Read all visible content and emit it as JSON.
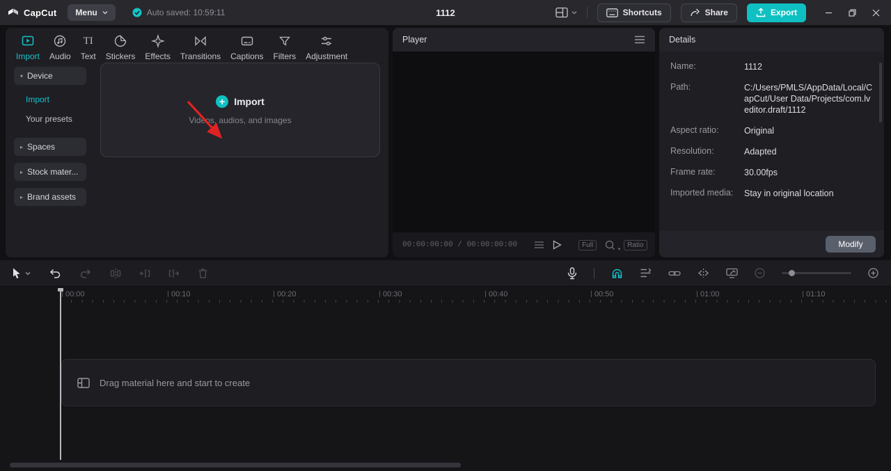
{
  "topbar": {
    "logo_text": "CapCut",
    "menu_label": "Menu",
    "autosave_text": "Auto saved: 10:59:11",
    "project_title": "1112",
    "shortcuts_label": "Shortcuts",
    "share_label": "Share",
    "export_label": "Export"
  },
  "media": {
    "tabs": [
      {
        "label": "Import"
      },
      {
        "label": "Audio"
      },
      {
        "label": "Text"
      },
      {
        "label": "Stickers"
      },
      {
        "label": "Effects"
      },
      {
        "label": "Transitions"
      },
      {
        "label": "Captions"
      },
      {
        "label": "Filters"
      },
      {
        "label": "Adjustment"
      }
    ],
    "text_icon_glyph": "TI",
    "sidebar": {
      "device": "Device",
      "import": "Import",
      "your_presets": "Your presets",
      "spaces": "Spaces",
      "stock_materials": "Stock mater...",
      "brand_assets": "Brand assets"
    },
    "import_zone": {
      "title": "Import",
      "subtitle": "Videos, audios, and images"
    }
  },
  "player": {
    "title": "Player",
    "time_current": "00:00:00:00",
    "time_separator": "/",
    "time_total": "00:00:00:00",
    "full_label": "Full",
    "ratio_label": "Ratio"
  },
  "details": {
    "title": "Details",
    "rows": [
      {
        "label": "Name:",
        "value": "1112"
      },
      {
        "label": "Path:",
        "value": "C:/Users/PMLS/AppData/Local/CapCut/User Data/Projects/com.lveditor.draft/1112"
      },
      {
        "label": "Aspect ratio:",
        "value": "Original"
      },
      {
        "label": "Resolution:",
        "value": "Adapted"
      },
      {
        "label": "Frame rate:",
        "value": "30.00fps"
      },
      {
        "label": "Imported media:",
        "value": "Stay in original location"
      }
    ],
    "modify_label": "Modify"
  },
  "timeline": {
    "ruler_labels": [
      "00:00",
      "00:10",
      "00:20",
      "00:30",
      "00:40",
      "00:50",
      "01:00",
      "01:10"
    ],
    "placeholder_text": "Drag material here and start to create"
  },
  "colors": {
    "accent_teal": "#14c4c8",
    "export_button": "#0fc0c2",
    "annotation_red": "#e02222"
  }
}
